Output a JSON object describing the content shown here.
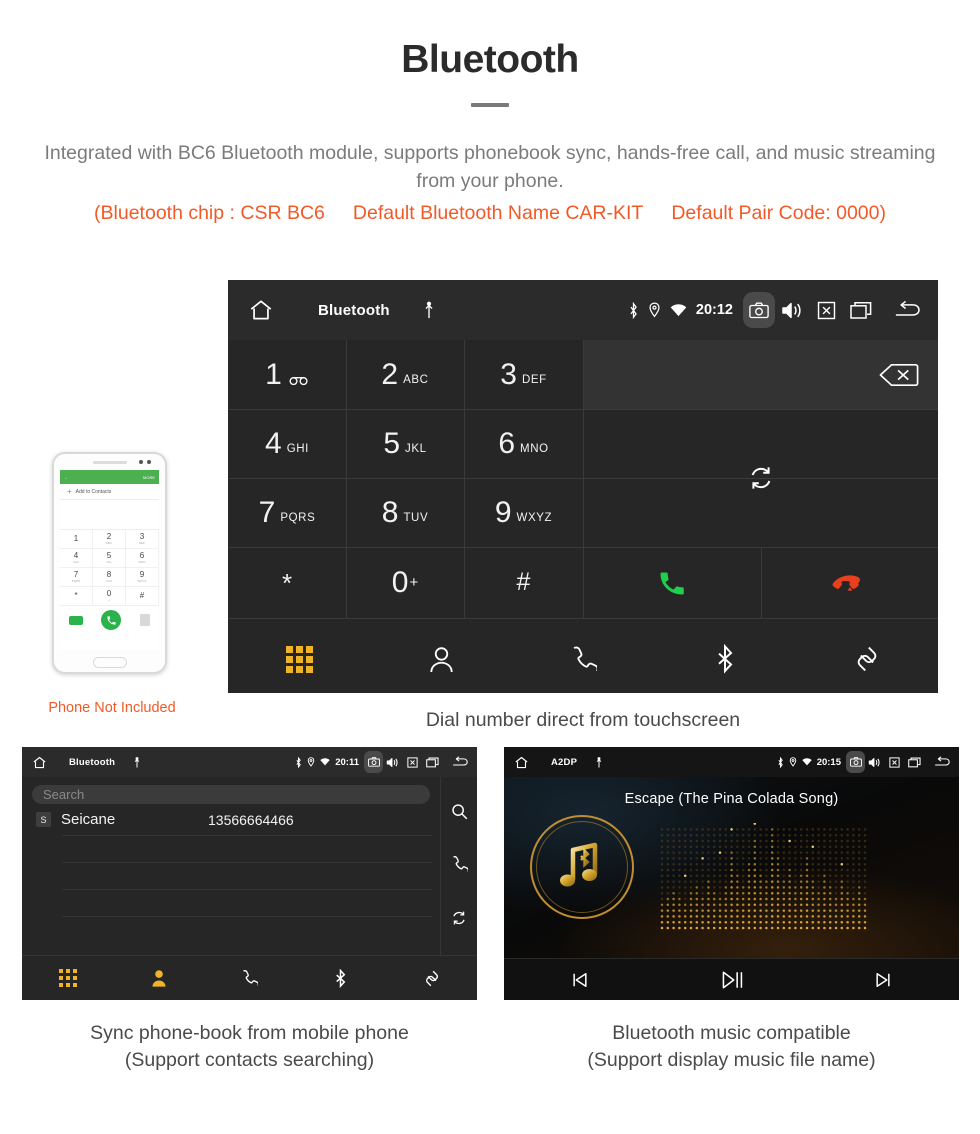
{
  "header": {
    "title": "Bluetooth",
    "description": "Integrated with BC6 Bluetooth module, supports phonebook sync, hands-free call, and music streaming from your phone.",
    "accent_chip": "(Bluetooth chip : CSR BC6",
    "accent_name": "Default Bluetooth Name CAR-KIT",
    "accent_pair": "Default Pair Code: 0000)",
    "accent_color": "#f05a28"
  },
  "main_screen": {
    "statusbar": {
      "home_icon": "home-icon",
      "title": "Bluetooth",
      "usb_icon": "usb-icon",
      "bluetooth_icon": "bluetooth-icon",
      "location_icon": "location-icon",
      "wifi_icon": "wifi-icon",
      "clock": "20:12",
      "camera_icon": "camera-icon",
      "volume_icon": "volume-icon",
      "close_icon": "close-box-icon",
      "recents_icon": "recents-icon",
      "back_icon": "back-icon"
    },
    "keypad": [
      {
        "digit": "1",
        "letters": "",
        "sup": ""
      },
      {
        "digit": "2",
        "letters": "ABC",
        "sup": ""
      },
      {
        "digit": "3",
        "letters": "DEF",
        "sup": ""
      },
      {
        "digit": "4",
        "letters": "GHI",
        "sup": ""
      },
      {
        "digit": "5",
        "letters": "JKL",
        "sup": ""
      },
      {
        "digit": "6",
        "letters": "MNO",
        "sup": ""
      },
      {
        "digit": "7",
        "letters": "PQRS",
        "sup": ""
      },
      {
        "digit": "8",
        "letters": "TUV",
        "sup": ""
      },
      {
        "digit": "9",
        "letters": "WXYZ",
        "sup": ""
      },
      {
        "digit": "*",
        "letters": "",
        "sup": ""
      },
      {
        "digit": "0",
        "letters": "",
        "sup": "+"
      },
      {
        "digit": "#",
        "letters": "",
        "sup": ""
      }
    ],
    "input_value": "",
    "backspace_icon": "backspace-icon",
    "sync_icon": "sync-icon",
    "call_icon": "call-icon",
    "hangup_icon": "hangup-icon",
    "call_color": "#1fd14a",
    "hangup_color": "#e8401f",
    "bottombar": [
      {
        "icon": "dialpad-icon",
        "active": true
      },
      {
        "icon": "contacts-icon",
        "active": false
      },
      {
        "icon": "call-log-icon",
        "active": false
      },
      {
        "icon": "bluetooth-icon",
        "active": false
      },
      {
        "icon": "link-icon",
        "active": false
      }
    ],
    "active_color": "#f0b429",
    "caption": "Dial number direct from touchscreen"
  },
  "phone_mock": {
    "status_label": "MORE",
    "add_contacts_label": "Add to Contacts",
    "keys": [
      {
        "n": "1",
        "l": ""
      },
      {
        "n": "2",
        "l": "ABC"
      },
      {
        "n": "3",
        "l": "DEF"
      },
      {
        "n": "4",
        "l": "GHI"
      },
      {
        "n": "5",
        "l": "JKL"
      },
      {
        "n": "6",
        "l": "MNO"
      },
      {
        "n": "7",
        "l": "PQRS"
      },
      {
        "n": "8",
        "l": "TUV"
      },
      {
        "n": "9",
        "l": "WXYZ"
      },
      {
        "n": "*",
        "l": ""
      },
      {
        "n": "0",
        "l": "+"
      },
      {
        "n": "#",
        "l": ""
      }
    ],
    "caption": "Phone Not Included",
    "caption_color": "#f05a28"
  },
  "phonebook_screen": {
    "statusbar": {
      "title": "Bluetooth",
      "clock": "20:11"
    },
    "search_placeholder": "Search",
    "contacts": [
      {
        "badge": "S",
        "name": "Seicane",
        "number": "13566664466"
      }
    ],
    "side_icons": [
      {
        "icon": "search-icon"
      },
      {
        "icon": "call-log-icon"
      },
      {
        "icon": "sync-icon"
      }
    ],
    "bottombar": [
      {
        "icon": "dialpad-icon",
        "active": false
      },
      {
        "icon": "contacts-icon",
        "active": true
      },
      {
        "icon": "call-log-icon",
        "active": false
      },
      {
        "icon": "bluetooth-icon",
        "active": false
      },
      {
        "icon": "link-icon",
        "active": false
      }
    ],
    "caption_line1": "Sync phone-book from mobile phone",
    "caption_line2": "(Support contacts searching)"
  },
  "a2dp_screen": {
    "statusbar": {
      "title": "A2DP",
      "clock": "20:15"
    },
    "track_title": "Escape (The Pina Colada Song)",
    "album_icon": "music-note-bluetooth-icon",
    "controls": [
      {
        "icon": "previous-icon"
      },
      {
        "icon": "play-pause-icon"
      },
      {
        "icon": "next-icon"
      }
    ],
    "caption_line1": "Bluetooth music compatible",
    "caption_line2": "(Support display music file name)"
  }
}
